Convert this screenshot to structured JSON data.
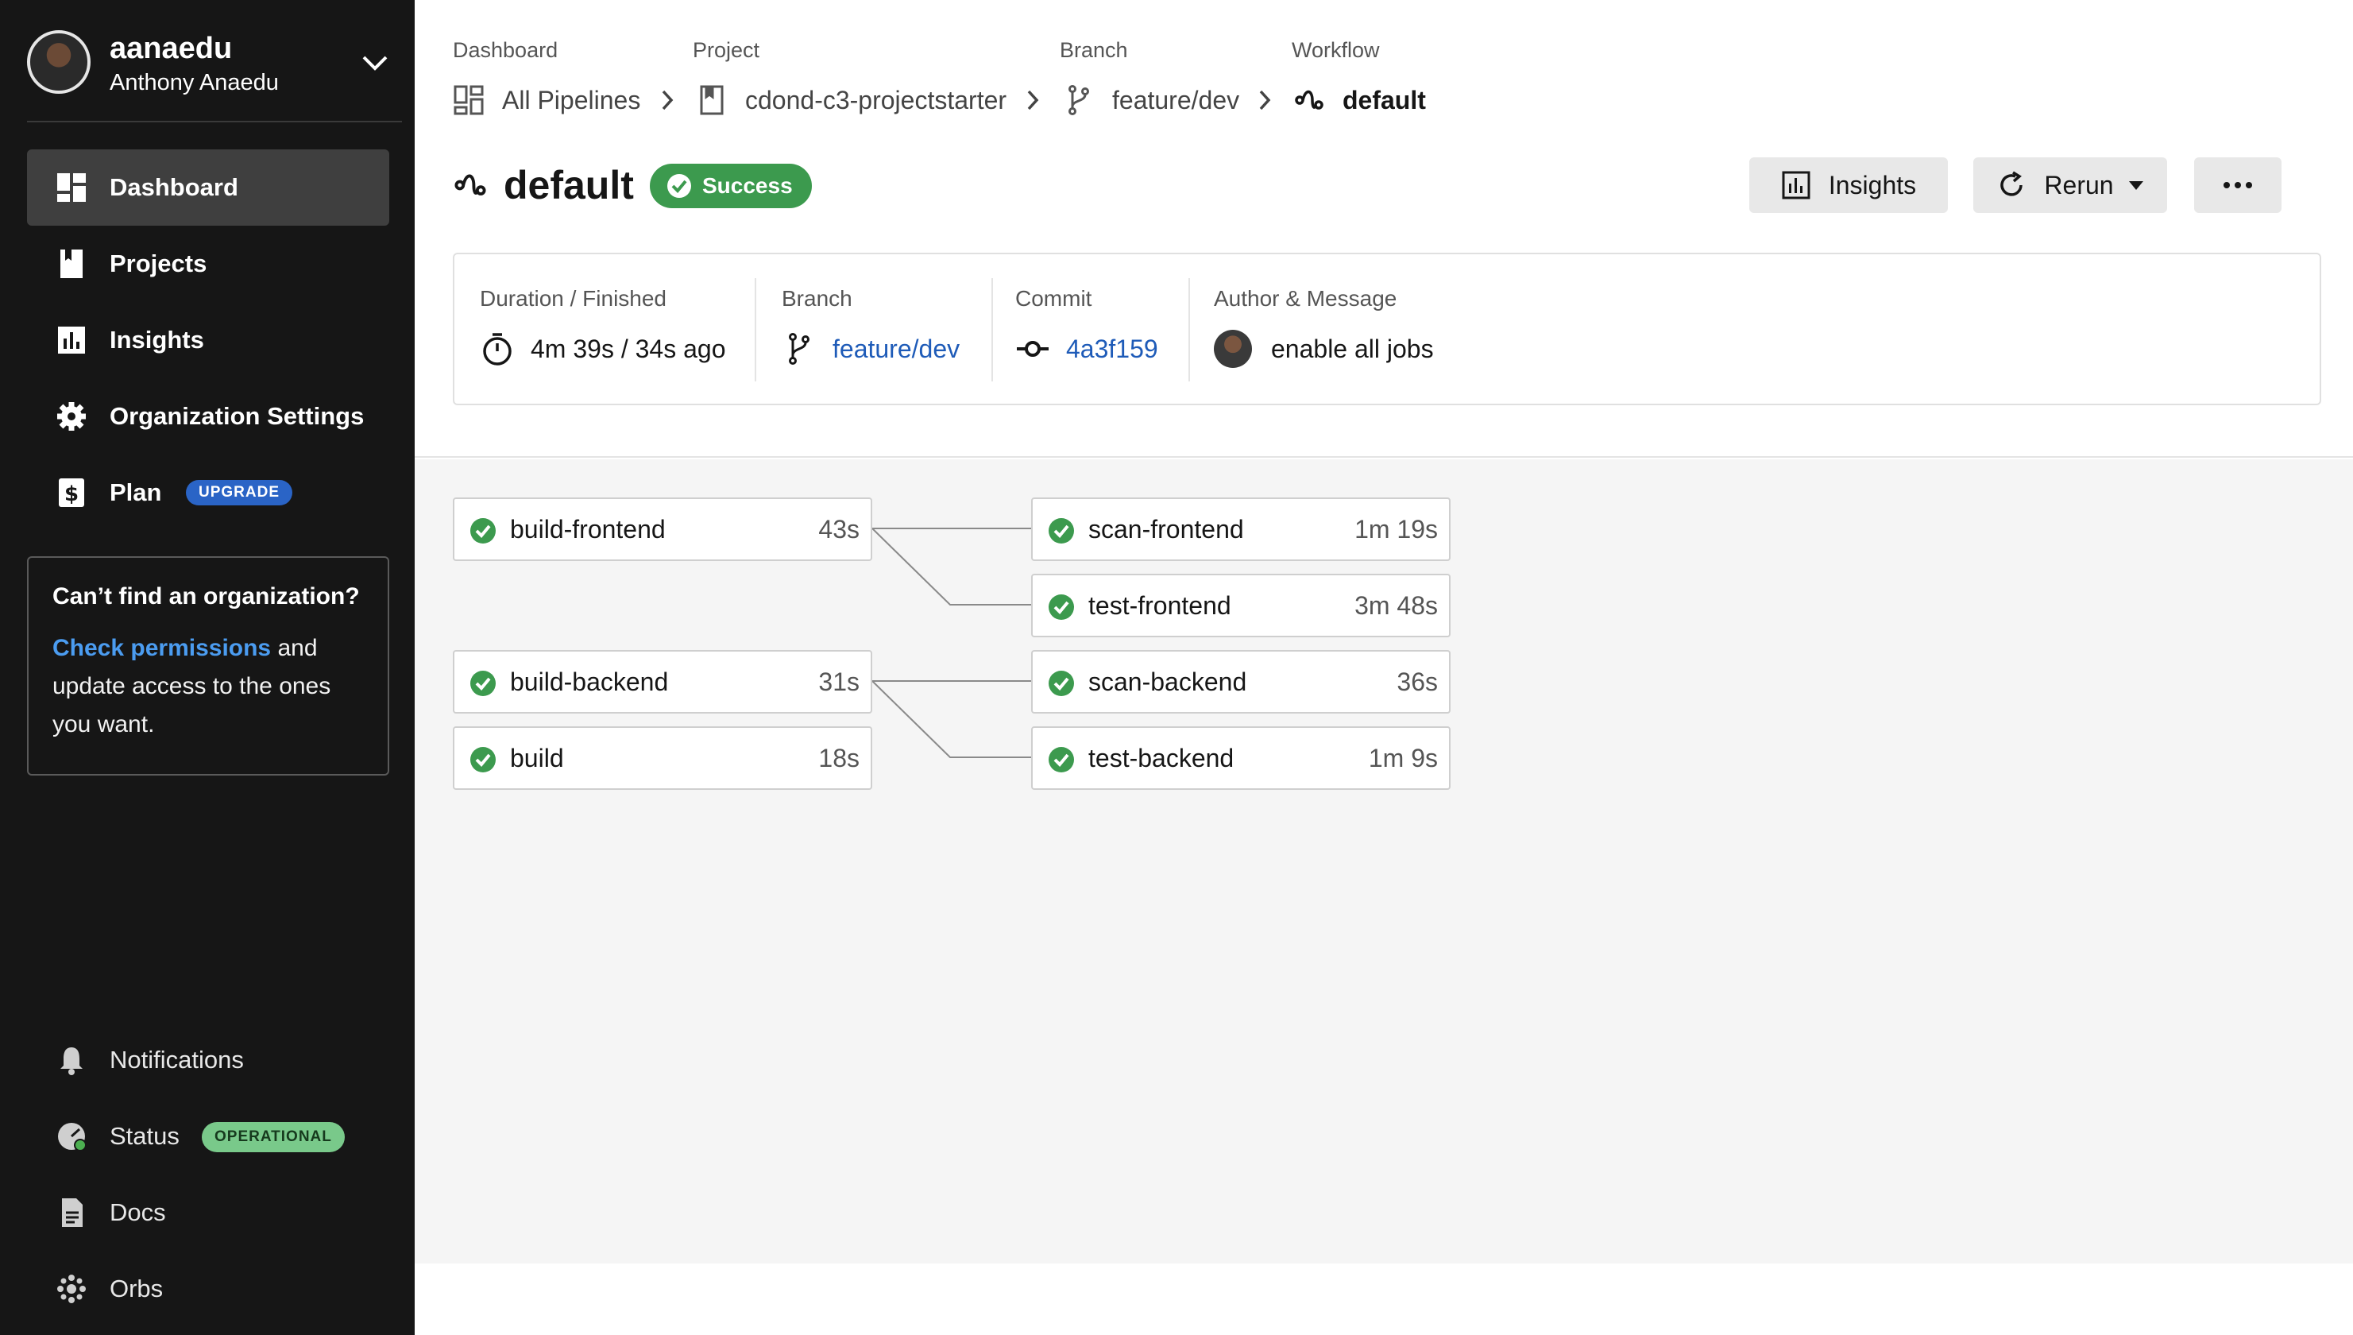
{
  "user": {
    "username": "aanaedu",
    "full_name": "Anthony Anaedu"
  },
  "nav": [
    {
      "label": "Dashboard",
      "icon": "dashboard-icon",
      "active": true
    },
    {
      "label": "Projects",
      "icon": "bookmark-icon"
    },
    {
      "label": "Insights",
      "icon": "bar-chart-icon"
    },
    {
      "label": "Organization Settings",
      "icon": "gear-icon"
    },
    {
      "label": "Plan",
      "icon": "dollar-icon",
      "badge": "UPGRADE"
    }
  ],
  "org_prompt": {
    "title": "Can’t find an organization?",
    "link": "Check permissions",
    "text": " and update access to the ones you want."
  },
  "bottom_nav": [
    {
      "label": "Notifications",
      "icon": "bell-icon"
    },
    {
      "label": "Status",
      "icon": "status-gauge-icon",
      "badge": "OPERATIONAL"
    },
    {
      "label": "Docs",
      "icon": "document-icon"
    },
    {
      "label": "Orbs",
      "icon": "orbs-icon"
    }
  ],
  "breadcrumb": {
    "dashboard": {
      "label": "Dashboard",
      "value": "All Pipelines"
    },
    "project": {
      "label": "Project",
      "value": "cdond-c3-projectstarter"
    },
    "branch": {
      "label": "Branch",
      "value": "feature/dev"
    },
    "workflow": {
      "label": "Workflow",
      "value": "default"
    }
  },
  "workflow": {
    "name": "default",
    "status": "Success"
  },
  "actions": {
    "insights": "Insights",
    "rerun": "Rerun"
  },
  "meta": {
    "duration_label": "Duration / Finished",
    "duration_value": "4m 39s / 34s ago",
    "branch_label": "Branch",
    "branch_value": "feature/dev",
    "commit_label": "Commit",
    "commit_value": "4a3f159",
    "author_label": "Author & Message",
    "message": "enable all jobs"
  },
  "jobs": [
    {
      "name": "build-frontend",
      "duration": "43s"
    },
    {
      "name": "build-backend",
      "duration": "31s"
    },
    {
      "name": "build",
      "duration": "18s"
    },
    {
      "name": "scan-frontend",
      "duration": "1m 19s"
    },
    {
      "name": "test-frontend",
      "duration": "3m 48s"
    },
    {
      "name": "scan-backend",
      "duration": "36s"
    },
    {
      "name": "test-backend",
      "duration": "1m 9s"
    }
  ],
  "colors": {
    "success": "#3c9a4e",
    "link": "#1e5bb8",
    "upgrade": "#2a64c6",
    "operational": "#79c98a",
    "sidebar": "#161616"
  }
}
